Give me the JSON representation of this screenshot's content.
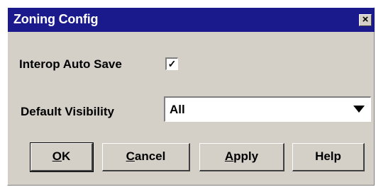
{
  "window": {
    "title": "Zoning Config",
    "close_glyph": "×"
  },
  "form": {
    "interop_label": "Interop Auto Save",
    "interop_checked_glyph": "✓",
    "interop_checked": true,
    "visibility_label": "Default Visibility",
    "visibility_value": "All"
  },
  "buttons": {
    "ok_mnemonic": "O",
    "ok_rest": "K",
    "cancel_mnemonic": "C",
    "cancel_rest": "ancel",
    "apply_mnemonic": "A",
    "apply_rest": "pply",
    "help_label": "Help"
  },
  "colors": {
    "titlebar": "#1a1a8c",
    "dialog_bg": "#d4d0c8"
  }
}
